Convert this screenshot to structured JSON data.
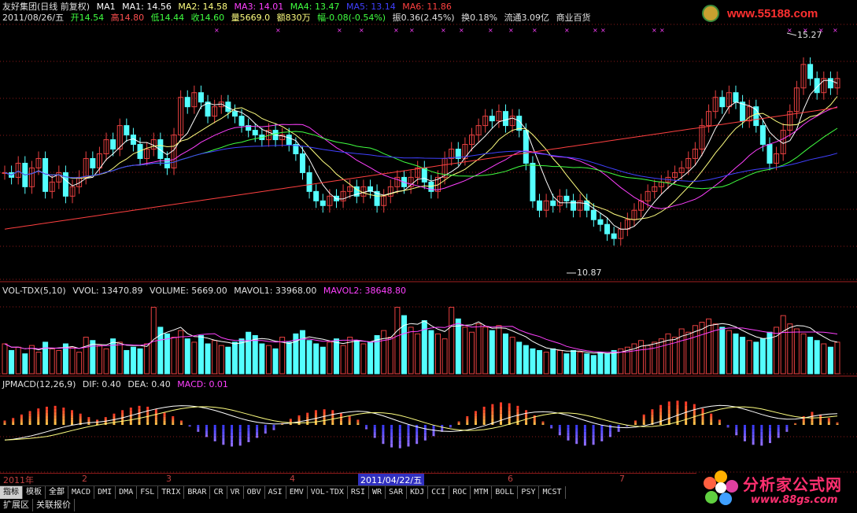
{
  "colors": {
    "up": "#e84040",
    "down": "#54ffff",
    "ma1": "#ffffff",
    "ma2": "#ffff80",
    "ma3": "#ff40ff",
    "ma4": "#40ff40",
    "ma5": "#4040ff",
    "ma6": "#ff4040",
    "grid": "#8b1a1a"
  },
  "header": {
    "title": "友好集团(日线 前复权)",
    "ma_label": "MA1",
    "ma1": "MA1: 14.56",
    "ma2": "MA2: 14.58",
    "ma3": "MA3: 14.01",
    "ma4": "MA4: 13.47",
    "ma5": "MA5: 13.14",
    "ma6": "MA6: 11.86",
    "date": "2011/08/26/五",
    "open": "开14.54",
    "high": "高14.80",
    "low": "低14.44",
    "close": "收14.60",
    "volume": "量5669.0",
    "amount": "额830万",
    "change": "幅-0.08(-0.54%)",
    "amplitude": "振0.36(2.45%)",
    "turnover": "换0.18%",
    "float": "流通3.09亿",
    "sector": "商业百货"
  },
  "watermark_top": "www.55188.com",
  "price_annotations": {
    "high": "15.27",
    "low": "10.87"
  },
  "vol_header": {
    "name": "VOL-TDX(5,10)",
    "vvol": "VVOL: 13470.89",
    "volume": "VOLUME: 5669.00",
    "mavol1": "MAVOL1: 33968.00",
    "mavol2": "MAVOL2: 38648.80"
  },
  "macd_header": {
    "name": "JPMACD(12,26,9)",
    "dif": "DIF: 0.40",
    "dea": "DEA: 0.40",
    "macd": "MACD: 0.01"
  },
  "time_axis": {
    "year": "2011年",
    "months": [
      "2",
      "3",
      "4",
      "5",
      "6",
      "7"
    ],
    "cursor_date": "2011/04/22/五"
  },
  "indicator_tabs": [
    "指标",
    "模板",
    "全部",
    "MACD",
    "DMI",
    "DMA",
    "FSL",
    "TRIX",
    "BRAR",
    "CR",
    "VR",
    "OBV",
    "ASI",
    "EMV",
    "VOL-TDX",
    "RSI",
    "WR",
    "SAR",
    "KDJ",
    "CCI",
    "ROC",
    "MTM",
    "BOLL",
    "PSY",
    "MCST"
  ],
  "bottom_tabs": [
    "扩展区",
    "关联报价"
  ],
  "logo": {
    "name": "分析家公式网",
    "url": "www.88gs.com"
  },
  "chart_data": {
    "type": "candlestick",
    "ylim": [
      10.5,
      15.6
    ],
    "close": [
      12.6,
      12.5,
      12.8,
      12.3,
      12.7,
      12.9,
      12.2,
      12.4,
      12.6,
      12.1,
      12.3,
      12.5,
      12.9,
      12.7,
      13.0,
      13.3,
      13.1,
      13.6,
      13.4,
      13.2,
      12.9,
      13.1,
      13.3,
      12.9,
      12.7,
      13.4,
      14.2,
      14.0,
      14.3,
      14.1,
      13.8,
      14.0,
      14.1,
      13.9,
      13.8,
      13.6,
      13.5,
      13.4,
      13.3,
      13.5,
      13.3,
      13.4,
      13.2,
      13.0,
      12.6,
      12.2,
      12.0,
      11.9,
      12.1,
      12.0,
      12.2,
      12.3,
      12.1,
      12.3,
      12.2,
      11.9,
      12.1,
      12.3,
      12.5,
      12.3,
      12.5,
      12.7,
      12.4,
      12.2,
      12.5,
      12.9,
      13.1,
      12.9,
      13.2,
      13.4,
      13.6,
      13.8,
      13.7,
      13.9,
      13.6,
      13.8,
      13.5,
      12.8,
      12.0,
      11.8,
      12.0,
      11.9,
      12.1,
      12.0,
      11.8,
      12.0,
      11.8,
      11.6,
      11.5,
      11.3,
      11.2,
      11.4,
      11.6,
      11.8,
      12.0,
      12.2,
      12.3,
      12.4,
      12.5,
      12.6,
      12.7,
      12.9,
      13.1,
      13.6,
      13.9,
      14.2,
      14.0,
      14.3,
      14.1,
      13.7,
      14.0,
      13.6,
      13.2,
      12.8,
      13.0,
      13.5,
      13.9,
      14.4,
      14.9,
      14.6,
      14.3,
      14.6,
      14.4,
      14.6
    ],
    "vol": [
      18,
      14,
      16,
      12,
      17,
      13,
      19,
      15,
      14,
      18,
      16,
      13,
      22,
      20,
      17,
      15,
      21,
      19,
      14,
      16,
      15,
      18,
      40,
      28,
      24,
      22,
      26,
      21,
      19,
      23,
      18,
      20,
      17,
      16,
      19,
      21,
      25,
      23,
      18,
      17,
      15,
      22,
      19,
      24,
      26,
      20,
      18,
      16,
      19,
      21,
      17,
      22,
      20,
      18,
      19,
      23,
      26,
      22,
      40,
      35,
      28,
      24,
      32,
      26,
      24,
      21,
      40,
      33,
      28,
      25,
      30,
      28,
      26,
      29,
      24,
      22,
      19,
      17,
      15,
      14,
      13,
      15,
      14,
      12,
      14,
      13,
      12,
      11,
      13,
      12,
      14,
      15,
      16,
      18,
      20,
      17,
      19,
      21,
      24,
      22,
      27,
      25,
      29,
      31,
      33,
      30,
      28,
      26,
      24,
      22,
      20,
      19,
      21,
      25,
      28,
      35,
      30,
      27,
      24,
      22,
      20,
      18,
      16,
      19
    ],
    "macd": [
      0.05,
      0.08,
      0.12,
      0.16,
      0.19,
      0.21,
      0.22,
      0.2,
      0.17,
      0.13,
      0.09,
      0.06,
      0.09,
      0.13,
      0.17,
      0.2,
      0.22,
      0.21,
      0.18,
      0.14,
      0.1,
      0.05,
      -0.02,
      -0.08,
      -0.14,
      -0.19,
      -0.23,
      -0.25,
      -0.24,
      -0.2,
      -0.15,
      -0.1,
      -0.06,
      0.02,
      0.07,
      0.11,
      0.14,
      0.17,
      0.18,
      0.17,
      0.14,
      0.1,
      0.06,
      -0.05,
      -0.15,
      -0.22,
      -0.26,
      -0.27,
      -0.25,
      -0.22,
      -0.18,
      -0.13,
      -0.08,
      -0.03,
      0.04,
      0.1,
      0.16,
      0.21,
      0.24,
      0.26,
      0.25,
      0.22,
      0.17,
      0.11,
      0.04,
      -0.04,
      -0.12,
      -0.18,
      -0.22,
      -0.24,
      -0.23,
      -0.19,
      -0.14,
      -0.08,
      -0.02,
      0.05,
      0.12,
      0.18,
      0.23,
      0.27,
      0.28,
      0.27,
      0.24,
      0.19,
      0.13,
      0.06,
      -0.03,
      -0.12,
      -0.19,
      -0.23,
      -0.24,
      -0.21,
      -0.15,
      -0.08,
      0.02,
      0.1,
      0.15,
      0.12,
      0.08,
      0.03
    ]
  }
}
